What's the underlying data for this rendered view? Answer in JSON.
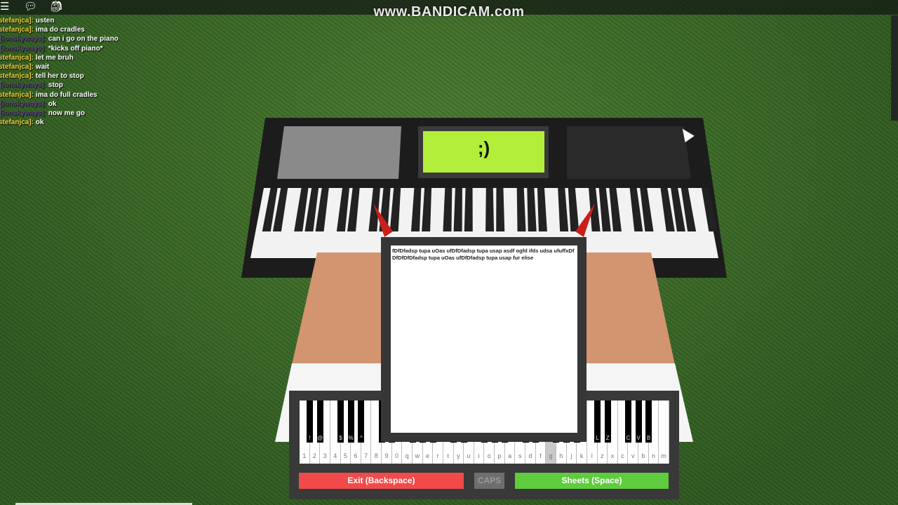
{
  "topbar": {
    "icons": [
      "menu-icon",
      "chat-icon",
      "backpack-icon"
    ],
    "watermark": "www.BANDICAM.com"
  },
  "chat": [
    {
      "name": "stefanjca]:",
      "style": "n1",
      "text": "usten"
    },
    {
      "name": "stefanjca]:",
      "style": "n1",
      "text": "ima do cradles"
    },
    {
      "name": "[ionskyways]:",
      "style": "n2",
      "text": "can i go on the piano"
    },
    {
      "name": "[ionskyways]:",
      "style": "n2",
      "text": "*kicks off piano*"
    },
    {
      "name": "stefanjca]:",
      "style": "n1",
      "text": "let me bruh"
    },
    {
      "name": "stefanjca]:",
      "style": "n1",
      "text": "wait"
    },
    {
      "name": "stefanjca]:",
      "style": "n1",
      "text": "tell her to stop"
    },
    {
      "name": "[ionskyways]:",
      "style": "n2",
      "text": "stop"
    },
    {
      "name": "stefanjca]:",
      "style": "n1",
      "text": "ima do full cradles"
    },
    {
      "name": "[ionskyways]:",
      "style": "n2",
      "text": "ok"
    },
    {
      "name": "[ionskyways]:",
      "style": "n2",
      "text": "now me go"
    },
    {
      "name": "stefanjca]:",
      "style": "n1",
      "text": "ok"
    }
  ],
  "piano": {
    "screen_text": ";)",
    "screen_color": "#b3ef3a"
  },
  "sheet": {
    "text": "fDfDfadsp tupa uOas ufDfDfadsp tupa usap asdf ogfd ifds udsa ufuffxDfDfDfDfDfadsp tupa uOas ufDfDfadsp tupa usap fur elise"
  },
  "keyboard": {
    "white_keys": [
      "1",
      "2",
      "3",
      "4",
      "5",
      "6",
      "7",
      "8",
      "9",
      "0",
      "q",
      "w",
      "e",
      "r",
      "t",
      "y",
      "u",
      "i",
      "o",
      "p",
      "a",
      "s",
      "d",
      "f",
      "g",
      "h",
      "j",
      "k",
      "l",
      "z",
      "x",
      "c",
      "v",
      "b",
      "n",
      "m"
    ],
    "black_keys": [
      "!",
      "@",
      "$",
      "%",
      "^",
      "*",
      "(",
      "Q",
      "W",
      "E",
      "T",
      "Y",
      "I",
      "O",
      "P",
      "S",
      "D",
      "G",
      "H",
      "J",
      "L",
      "Z",
      "C",
      "V",
      "B"
    ],
    "highlighted": "g"
  },
  "buttons": {
    "exit": "Exit (Backspace)",
    "caps": "CAPS",
    "sheets": "Sheets (Space)"
  },
  "colors": {
    "exit": "#f24a4a",
    "caps": "#6e6e6e",
    "sheets": "#5ecc3c"
  }
}
